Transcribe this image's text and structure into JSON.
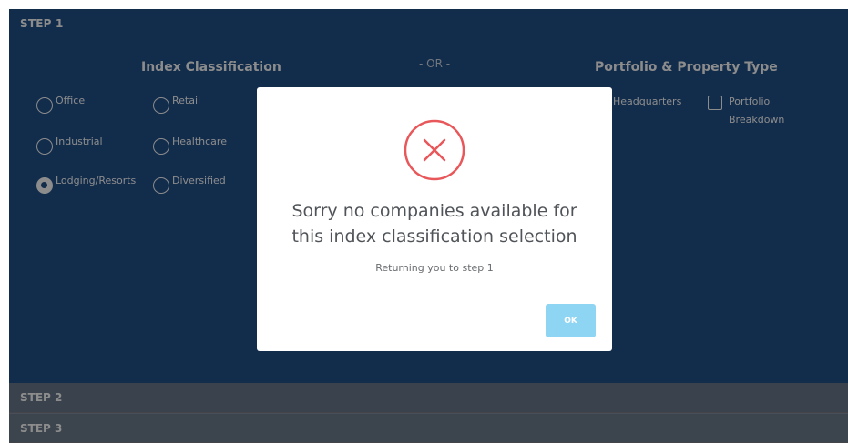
{
  "step1": {
    "title": "STEP 1",
    "index_classification": {
      "header": "Index Classification",
      "options": [
        {
          "label": "Office",
          "checked": false
        },
        {
          "label": "Retail",
          "checked": false
        },
        {
          "label": "Industrial",
          "checked": false
        },
        {
          "label": "Healthcare",
          "checked": false
        },
        {
          "label": "Lodging/Resorts",
          "checked": true
        },
        {
          "label": "Diversified",
          "checked": false
        }
      ]
    },
    "or_label": "- OR -",
    "portfolio": {
      "header": "Portfolio & Property Type",
      "options": [
        {
          "label": "Headquarters",
          "checked": false
        },
        {
          "label_line1": "Portfolio",
          "label_line2": "Breakdown",
          "checked": false
        }
      ]
    }
  },
  "step2": {
    "title": "STEP 2"
  },
  "step3": {
    "title": "STEP 3"
  },
  "modal": {
    "icon": "close-circle-icon",
    "title_line1": "Sorry no companies available for",
    "title_line2": "this index classification selection",
    "message": "Returning you to step 1",
    "ok_label": "OK"
  },
  "colors": {
    "panel_bg": "#21518a",
    "step_bar_bg": "#6a7a8c",
    "error_red": "#e8585b",
    "ok_button": "#8ed4f3"
  }
}
